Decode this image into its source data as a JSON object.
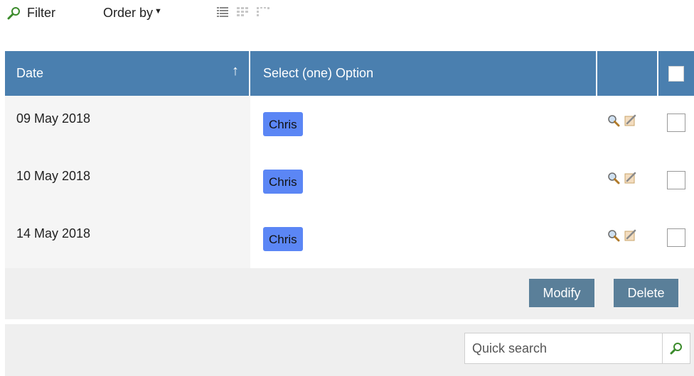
{
  "toolbar": {
    "filter_label": "Filter",
    "order_label": "Order by",
    "order_caret": "▼",
    "views": [
      "list-view-icon",
      "grid-view-icon",
      "tiles-view-icon"
    ]
  },
  "table": {
    "columns": {
      "date": "Date",
      "sort_indicator": "↑",
      "option": "Select (one) Option"
    },
    "rows": [
      {
        "date": "09 May 2018",
        "option": "Chris"
      },
      {
        "date": "10 May 2018",
        "option": "Chris"
      },
      {
        "date": "14 May 2018",
        "option": "Chris"
      }
    ]
  },
  "actions": {
    "modify_label": "Modify",
    "delete_label": "Delete"
  },
  "search": {
    "placeholder": "Quick search"
  },
  "colors": {
    "header_bg": "#4a7faf",
    "tag_bg": "#5b86f5",
    "button_bg": "#5a7f99",
    "bar_bg": "#efefef"
  }
}
